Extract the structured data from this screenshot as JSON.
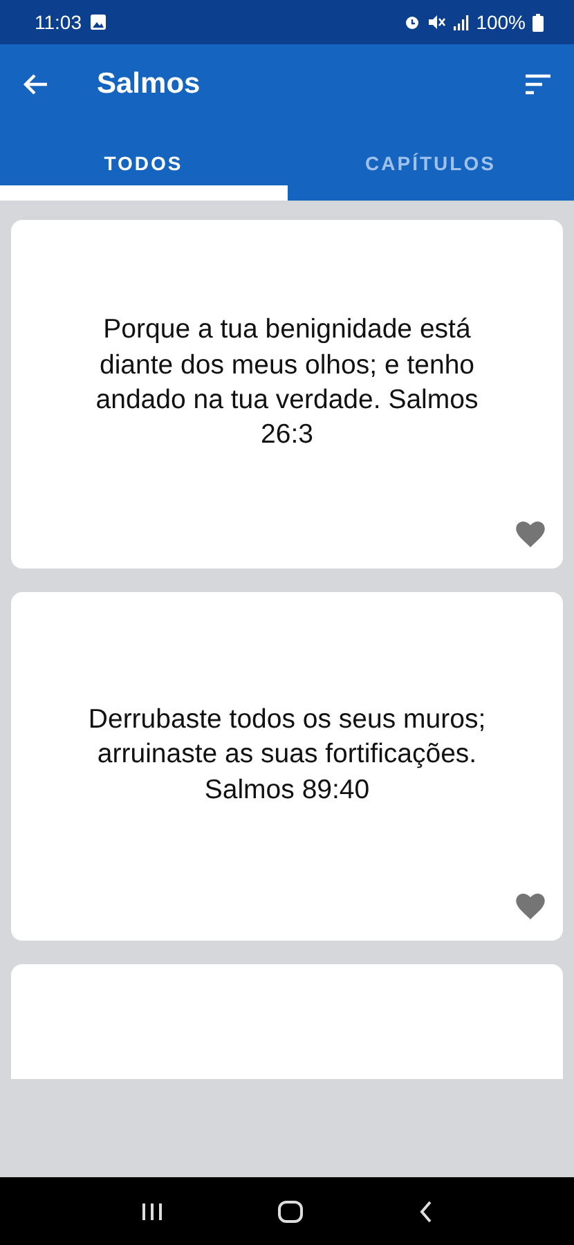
{
  "status_bar": {
    "time": "11:03",
    "battery": "100%"
  },
  "app_bar": {
    "title": "Salmos"
  },
  "tabs": [
    {
      "label": "TODOS",
      "selected": true
    },
    {
      "label": "CAPÍTULOS",
      "selected": false
    }
  ],
  "verses": [
    {
      "kind": "verse",
      "text": "Porque a tua benignidade está diante dos meus olhos; e tenho andado na tua verdade. Salmos 26:3"
    },
    {
      "kind": "verse",
      "text": "Derrubaste todos os seus muros; arruinaste as suas fortificações. Salmos 89:40"
    },
    {
      "kind": "cut_off"
    }
  ]
}
